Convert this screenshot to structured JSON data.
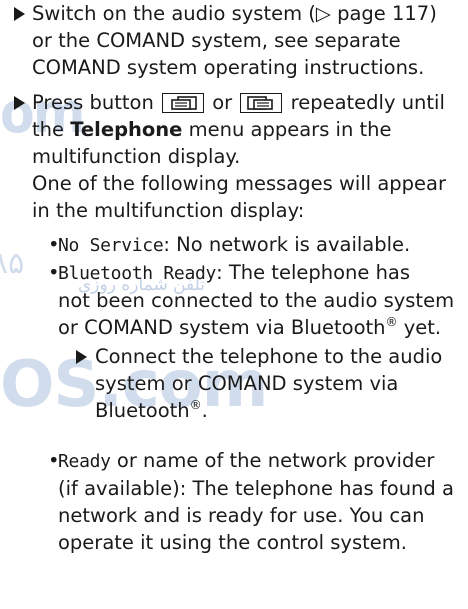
{
  "watermark": {
    "top": "om",
    "mid": "۸۵",
    "mid_small": "تلفن شماره روزی",
    "bottom": "OS.com"
  },
  "steps": [
    {
      "line1": "Switch on the audio system (▷ page 117)",
      "line2": "or the COMAND system, see separate",
      "line3": "COMAND system operating instructions."
    },
    {
      "press_prefix": "Press button",
      "or": "or",
      "line1_suffix": "repeatedly until",
      "line2_pre": "the",
      "line2_bold": "Telephone",
      "line2_post": "menu appears in the",
      "line3": "multifunction display.",
      "line4": "One of the following messages will appear",
      "line5": "in the multifunction display:"
    }
  ],
  "messages": [
    {
      "code": "No Service",
      "text": ": No network is available."
    },
    {
      "code": "Bluetooth Ready",
      "text1": ": The telephone has",
      "text2": "not been connected to the audio system",
      "text3": "or COMAND system via Bluetooth",
      "reg": "®",
      "text3_end": " yet.",
      "substep": {
        "line1": "Connect the telephone to the audio",
        "line2": "system or COMAND system via",
        "line3": "Bluetooth",
        "reg": "®",
        "end": "."
      }
    },
    {
      "code": "Ready",
      "text1": " or name of the network provider",
      "text2": "(if available): The telephone has found a",
      "text3": "network and is ready for use. You can",
      "text4": "operate it using the control system."
    }
  ],
  "bullet_char": "•",
  "icons": [
    "arrow-right-icon",
    "display-page-back-icon",
    "display-page-forward-icon"
  ]
}
